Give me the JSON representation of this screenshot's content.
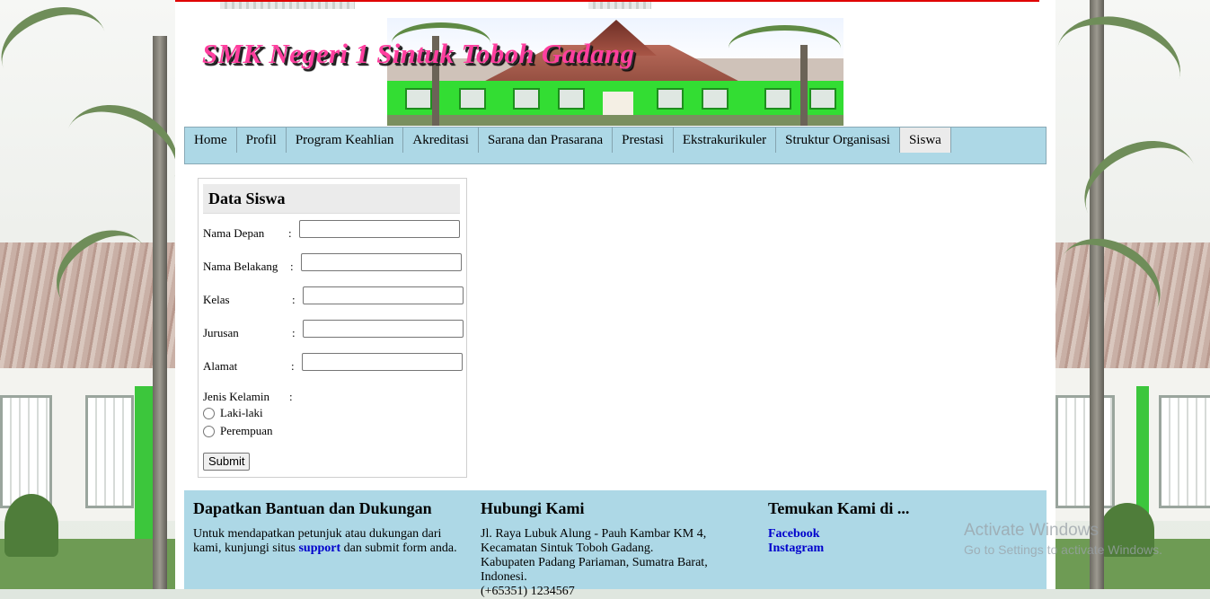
{
  "header": {
    "title": "SMK Negeri 1 Sintuk Toboh Gadang"
  },
  "nav": {
    "items": [
      {
        "label": "Home"
      },
      {
        "label": "Profil"
      },
      {
        "label": "Program Keahlian"
      },
      {
        "label": "Akreditasi"
      },
      {
        "label": "Sarana dan Prasarana"
      },
      {
        "label": "Prestasi"
      },
      {
        "label": "Ekstrakurikuler"
      },
      {
        "label": "Struktur Organisasi"
      },
      {
        "label": "Siswa"
      }
    ],
    "active": "Siswa"
  },
  "form": {
    "title": "Data Siswa",
    "colon": ":",
    "fields": [
      {
        "label": "Nama Depan",
        "value": ""
      },
      {
        "label": "Nama Belakang",
        "value": ""
      },
      {
        "label": "Kelas",
        "value": ""
      },
      {
        "label": "Jurusan",
        "value": ""
      },
      {
        "label": "Alamat",
        "value": ""
      }
    ],
    "gender_label": "Jenis Kelamin",
    "gender_options": [
      "Laki-laki",
      "Perempuan"
    ],
    "submit_label": "Submit"
  },
  "footer": {
    "help": {
      "title": "Dapatkan Bantuan dan Dukungan",
      "text_before": "Untuk mendapatkan petunjuk atau dukungan dari kami, kunjungi situs ",
      "link": "support",
      "text_after": " dan submit form anda."
    },
    "contact": {
      "title": "Hubungi Kami",
      "address_1": "Jl. Raya Lubuk Alung - Pauh Kambar KM 4,",
      "address_2": "Kecamatan Sintuk Toboh Gadang.",
      "address_3": "Kabupaten Padang Pariaman, Sumatra Barat,",
      "address_4": "Indonesi.",
      "phone": "(+65351) 1234567"
    },
    "social": {
      "title": "Temukan Kami di ...",
      "links": [
        "Facebook",
        "Instagram"
      ]
    }
  },
  "watermark": {
    "line1": "Activate Windows",
    "line2": "Go to Settings to activate Windows."
  },
  "colors": {
    "nav_bg": "#add8e6",
    "active_tab": "#ebebeb",
    "accent_red": "#e00000",
    "title_pink": "#ff3f9f",
    "link_blue": "#0000cc"
  }
}
